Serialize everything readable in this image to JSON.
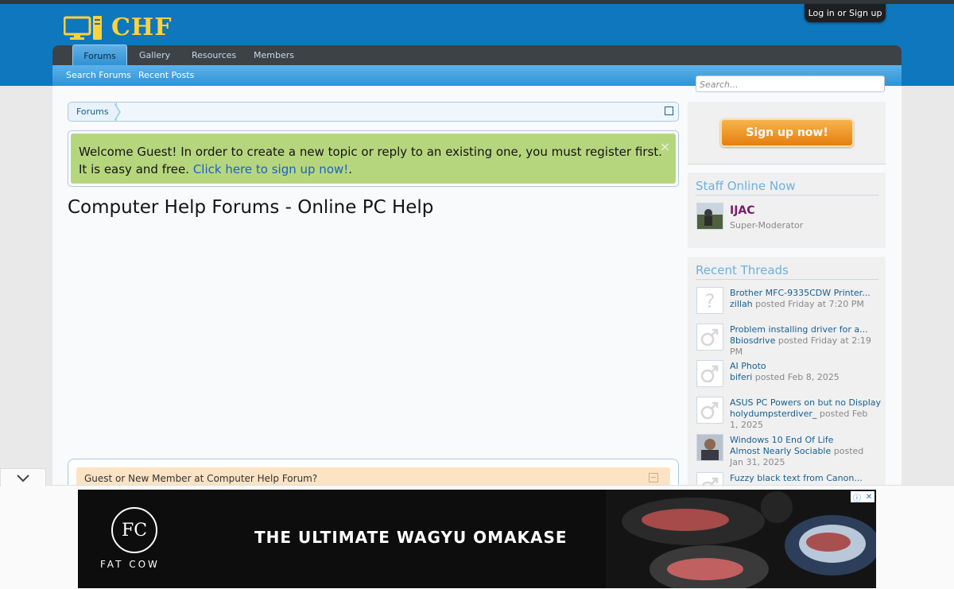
{
  "header": {
    "logo_text": "CHF",
    "login_label": "Log in or Sign up"
  },
  "nav": {
    "tabs": [
      {
        "label": "Forums",
        "active": true
      },
      {
        "label": "Gallery",
        "active": false
      },
      {
        "label": "Resources",
        "active": false
      },
      {
        "label": "Members",
        "active": false
      }
    ],
    "subnav": [
      "Search Forums",
      "Recent Posts"
    ]
  },
  "search": {
    "placeholder": "Search..."
  },
  "breadcrumb": {
    "items": [
      "Forums"
    ]
  },
  "notice": {
    "text": "Welcome Guest! In order to create a new topic or reply to an existing one, you must register first. It is easy and free.",
    "link": "Click here to sign up now!",
    "after": ".",
    "close": "×"
  },
  "page": {
    "title": "Computer Help Forums - Online PC Help"
  },
  "guest_box": {
    "title": "Guest or New Member at Computer Help Forum?"
  },
  "sidebar": {
    "signup_label": "Sign up now!",
    "staff": {
      "heading": "Staff Online Now",
      "members": [
        {
          "name": "IJAC",
          "role": "Super-Moderator"
        }
      ]
    },
    "recent": {
      "heading": "Recent Threads",
      "threads": [
        {
          "title": "Brother MFC-9335CDW Printer...",
          "user": "zillah",
          "meta": "posted Friday at 7:20 PM",
          "avatar": "question-avatar"
        },
        {
          "title": "Problem installing driver for a...",
          "user": "8biosdrive",
          "meta": "posted Friday at 2:19 PM",
          "avatar": "male-avatar"
        },
        {
          "title": "AI Photo",
          "user": "biferi",
          "meta": "posted Feb 8, 2025",
          "avatar": "male-avatar"
        },
        {
          "title": "ASUS PC Powers on but no Display",
          "user": "holydumpsterdiver_",
          "meta": "posted Feb 1, 2025",
          "avatar": "male-avatar"
        },
        {
          "title": "Windows 10 End Of Life",
          "user": "Almost Nearly Sociable",
          "meta": "posted Jan 31, 2025",
          "avatar": "photo-avatar"
        },
        {
          "title": "Fuzzy black text from Canon...",
          "user": "",
          "meta": "",
          "avatar": "male-avatar"
        }
      ]
    }
  },
  "ad": {
    "logo_initials": "FC",
    "brand": "FAT COW",
    "headline": "THE ULTIMATE WAGYU OMAKASE"
  },
  "colors": {
    "header_blue": "#0f77bd",
    "nav_dark": "#3d4247",
    "notice_green": "#b6d67d",
    "signup_orange": "#e57f10",
    "link_blue": "#176093",
    "logo_yellow": "#ffd23e"
  }
}
